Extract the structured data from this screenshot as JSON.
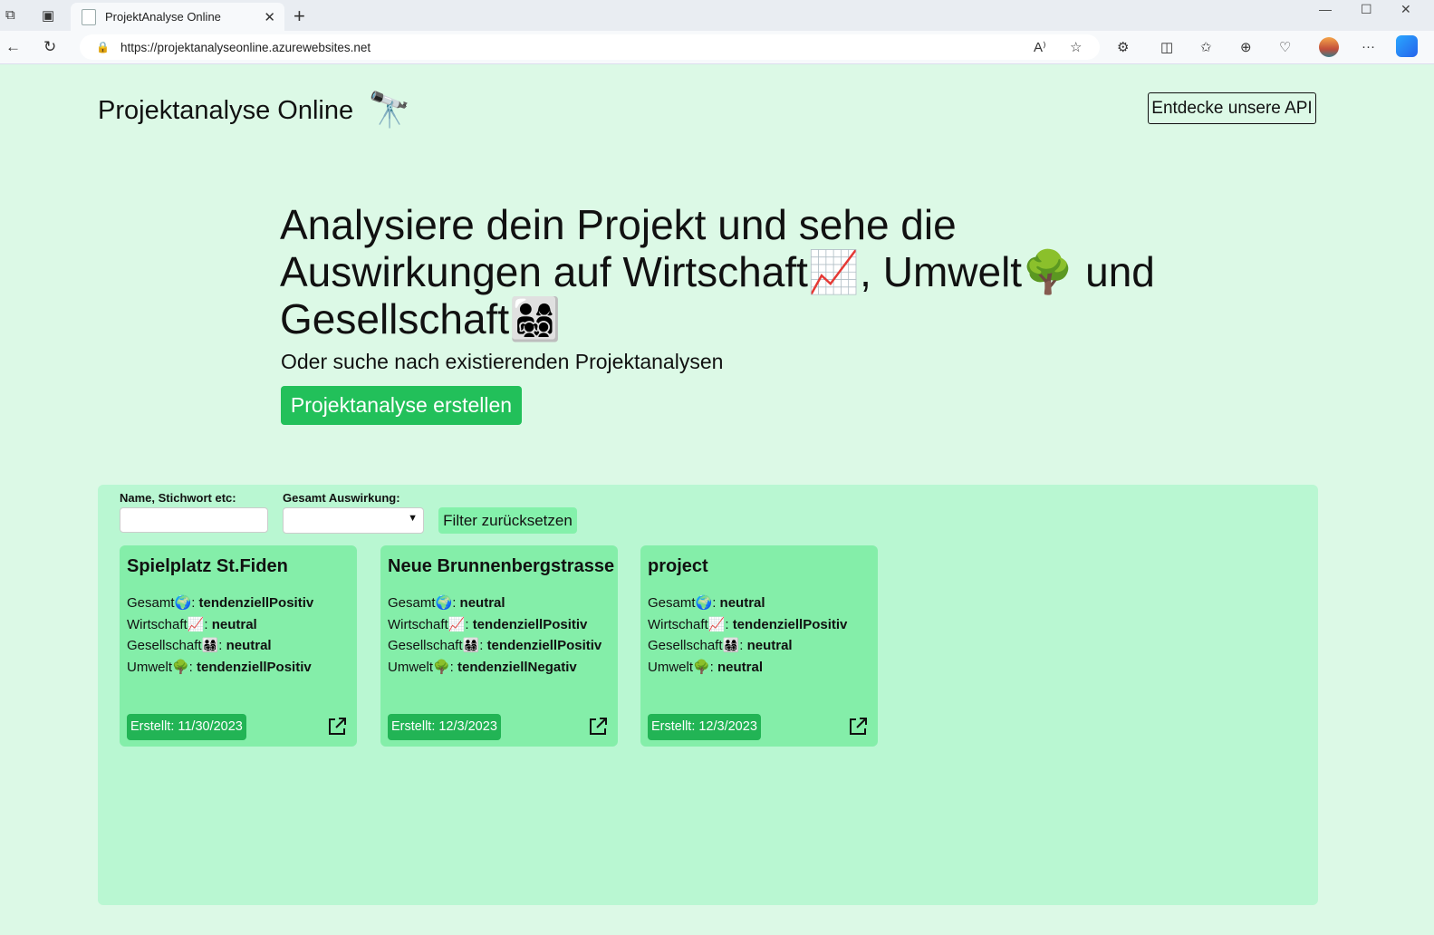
{
  "browser": {
    "tab_title": "ProjektAnalyse Online",
    "tab_close": "✕",
    "new_tab": "+",
    "url": "https://projektanalyseonline.azurewebsites.net",
    "back": "←",
    "reload": "↻",
    "menu": "···"
  },
  "header": {
    "brand": "Projektanalyse Online",
    "brand_icon": "🔭",
    "api_button": "Entdecke unsere API"
  },
  "hero": {
    "title": "Analysiere dein Projekt und sehe die Auswirkungen auf Wirtschaft📈, Umwelt🌳 und Gesellschaft👨‍👩‍👧‍👦",
    "subtitle": "Oder suche nach existierenden Projektanalysen",
    "create_button": "Projektanalyse erstellen"
  },
  "filters": {
    "name_label": "Name, Stichwort etc:",
    "name_value": "",
    "impact_label": "Gesamt Auswirkung:",
    "impact_value": "",
    "reset_button": "Filter zurücksetzen"
  },
  "cards": [
    {
      "title": "Spielplatz St.Fiden",
      "gesamt": "tendenziellPositiv",
      "wirtschaft": "neutral",
      "gesellschaft": "neutral",
      "umwelt": "tendenziellPositiv",
      "created": "Erstellt: 11/30/2023"
    },
    {
      "title": "Neue Brunnenbergstrasse",
      "gesamt": "neutral",
      "wirtschaft": "tendenziellPositiv",
      "gesellschaft": "tendenziellPositiv",
      "umwelt": "tendenziellNegativ",
      "created": "Erstellt: 12/3/2023"
    },
    {
      "title": "project",
      "gesamt": "neutral",
      "wirtschaft": "tendenziellPositiv",
      "gesellschaft": "neutral",
      "umwelt": "neutral",
      "created": "Erstellt: 12/3/2023"
    }
  ],
  "card_labels": {
    "gesamt": "Gesamt🌍: ",
    "wirtschaft": "Wirtschaft📈: ",
    "gesellschaft": "Gesellschaft👨‍👩‍👧‍👦: ",
    "umwelt": "Umwelt🌳: "
  },
  "colors": {
    "page_bg": "#dcf9e6",
    "panel_bg": "#b9f7d2",
    "card_bg": "#84eea9",
    "accent": "#22c05a"
  }
}
